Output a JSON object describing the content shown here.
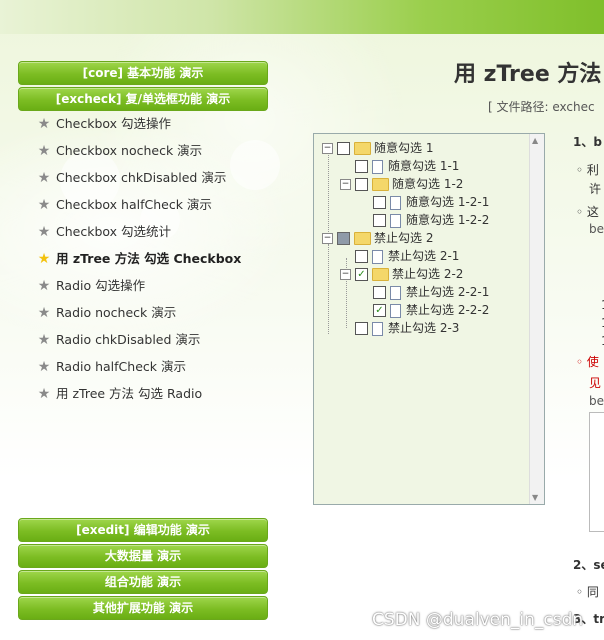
{
  "menu_top": [
    {
      "label": "[core] 基本功能 演示"
    },
    {
      "label": "[excheck] 复/单选框功能 演示"
    }
  ],
  "submenu": [
    {
      "label": "Checkbox 勾选操作",
      "active": false
    },
    {
      "label": "Checkbox nocheck 演示",
      "active": false
    },
    {
      "label": "Checkbox chkDisabled 演示",
      "active": false
    },
    {
      "label": "Checkbox halfCheck 演示",
      "active": false
    },
    {
      "label": "Checkbox 勾选统计",
      "active": false
    },
    {
      "label": "用 zTree 方法 勾选 Checkbox",
      "active": true
    },
    {
      "label": "Radio 勾选操作",
      "active": false
    },
    {
      "label": "Radio nocheck 演示",
      "active": false
    },
    {
      "label": "Radio chkDisabled 演示",
      "active": false
    },
    {
      "label": "Radio halfCheck 演示",
      "active": false
    },
    {
      "label": "用 zTree 方法 勾选 Radio",
      "active": false
    }
  ],
  "menu_bottom": [
    {
      "label": "[exedit] 编辑功能 演示"
    },
    {
      "label": "大数据量 演示"
    },
    {
      "label": "组合功能 演示"
    },
    {
      "label": "其他扩展功能 演示"
    }
  ],
  "page_title": "用 zTree 方法",
  "file_path": "[ 文件路径: exchec",
  "tree": [
    {
      "label": "随意勾选 1",
      "check": "none",
      "type": "folder"
    },
    {
      "label": "随意勾选 1-1",
      "check": "none",
      "type": "file"
    },
    {
      "label": "随意勾选 1-2",
      "check": "none",
      "type": "folder"
    },
    {
      "label": "随意勾选 1-2-1",
      "check": "none",
      "type": "file"
    },
    {
      "label": "随意勾选 1-2-2",
      "check": "none",
      "type": "file"
    },
    {
      "label": "禁止勾选 2",
      "check": "partial",
      "type": "folder"
    },
    {
      "label": "禁止勾选 2-1",
      "check": "none",
      "type": "file"
    },
    {
      "label": "禁止勾选 2-2",
      "check": "checked",
      "type": "folder"
    },
    {
      "label": "禁止勾选 2-2-1",
      "check": "none",
      "type": "file"
    },
    {
      "label": "禁止勾选 2-2-2",
      "check": "checked",
      "type": "file"
    },
    {
      "label": "禁止勾选 2-3",
      "check": "none",
      "type": "file"
    }
  ],
  "right_fragments": {
    "h1": "1、b",
    "b1a": "利",
    "b1b": "许",
    "b2a": "这",
    "b2b": "be",
    "c1": "1",
    "c2": "1",
    "c3": "1",
    "red1": "使",
    "red2": "见",
    "be3": "be",
    "h2": "2、se",
    "b3": "同",
    "h3": "3、tr"
  },
  "watermark": "CSDN @dualven_in_csdn"
}
